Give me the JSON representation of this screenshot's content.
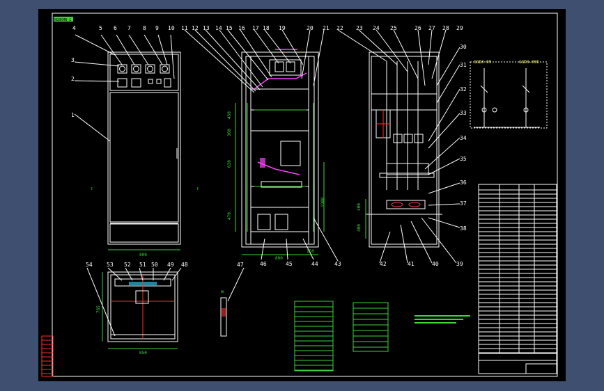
{
  "drawing": {
    "title_stamp": "NGBKMN-1",
    "part_numbers": [
      "1",
      "2",
      "3",
      "4",
      "5",
      "6",
      "7",
      "8",
      "9",
      "10",
      "11",
      "12",
      "13",
      "14",
      "15",
      "16",
      "17",
      "18",
      "19",
      "20",
      "21",
      "22",
      "23",
      "24",
      "25",
      "26",
      "27",
      "28",
      "29",
      "30",
      "31",
      "32",
      "33",
      "34",
      "35",
      "36",
      "37",
      "38",
      "39",
      "40",
      "41",
      "42",
      "43",
      "44",
      "45",
      "46",
      "47",
      "48",
      "49",
      "50",
      "51",
      "52",
      "53",
      "54"
    ],
    "dimensions": {
      "front_width": "800",
      "side_width": "800",
      "side_sub": "150",
      "plan_width": "850",
      "plan_depth": "765",
      "h1": "360",
      "h2": "450",
      "h3": "630",
      "h4": "470",
      "h5": "1900",
      "r1": "300",
      "r2": "400"
    },
    "schematic_labels": [
      "GGD3-09",
      "GGD3-09E"
    ],
    "colors": {
      "line": "#ffffff",
      "dim": "#3bd63b",
      "accent": "#ff40ff",
      "red": "#ff3030",
      "cyan": "#30e0ff",
      "bg": "#000000",
      "frame": "#3f4f6f"
    }
  }
}
